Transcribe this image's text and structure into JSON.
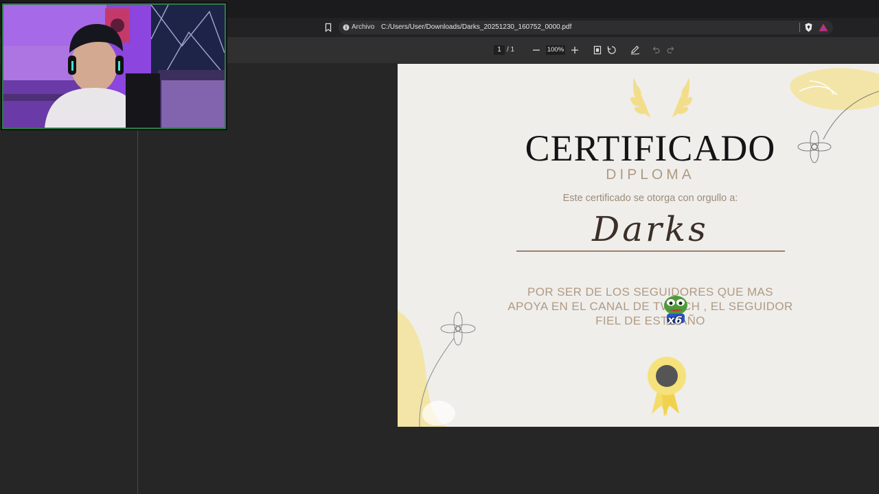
{
  "browser": {
    "site_label": "Archivo",
    "url": "C:/Users/User/Downloads/Darks_20251230_160752_0000.pdf"
  },
  "pdf_toolbar": {
    "current_page": "1",
    "page_separator": "/ 1",
    "zoom": "100%"
  },
  "certificate": {
    "title": "CERTIFICADO",
    "subtitle": "DIPLOMA",
    "grant_text": "Este certificado se otorga con orgullo a:",
    "recipient": "Darks",
    "reason_line1": "POR SER DE LOS SEGUIDORES  QUE MAS",
    "reason_line2": "APOYA EN EL CANAL DE TWITCH , EL SEGUIDOR",
    "reason_line3": "FIEL DE ESTE AÑO"
  },
  "emote": {
    "label": "x6"
  },
  "colors": {
    "accent_yellow": "#f3e39b",
    "text_brown": "#b09a82",
    "webcam_border": "#2f7a4b"
  }
}
